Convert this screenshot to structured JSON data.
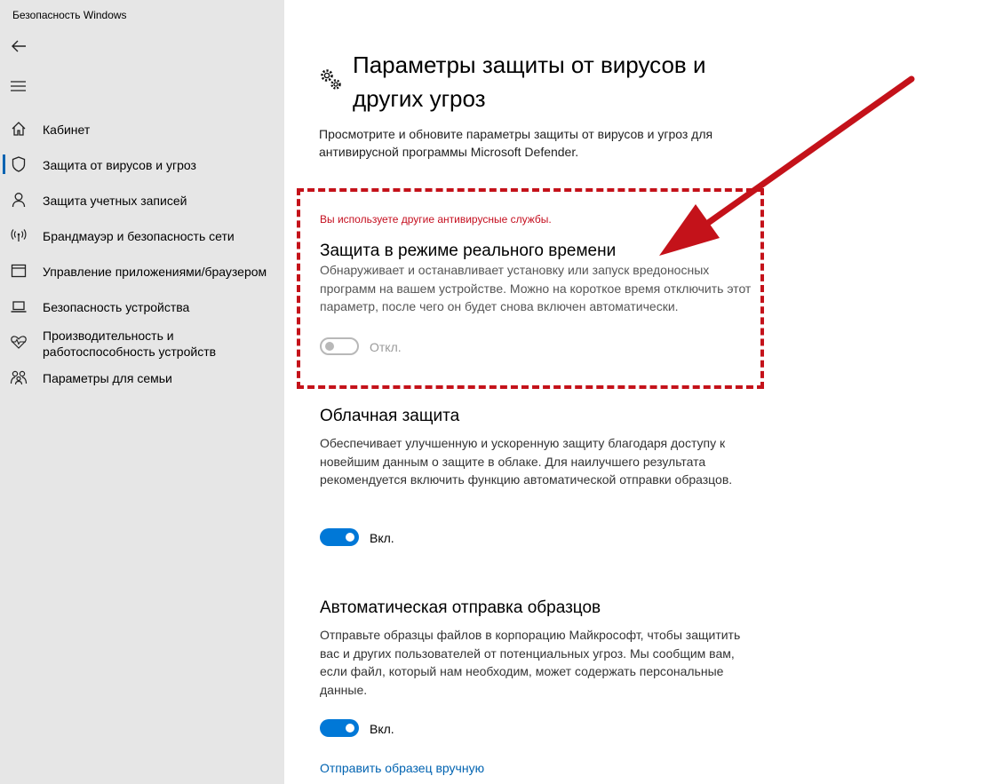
{
  "window": {
    "title": "Безопасность Windows"
  },
  "sidebar": {
    "items": [
      {
        "label": "Кабинет",
        "icon": "home-icon"
      },
      {
        "label": "Защита от вирусов и угроз",
        "icon": "shield-icon"
      },
      {
        "label": "Защита учетных записей",
        "icon": "person-icon"
      },
      {
        "label": "Брандмауэр и безопасность сети",
        "icon": "wifi-signal-icon"
      },
      {
        "label": "Управление приложениями/браузером",
        "icon": "app-window-icon"
      },
      {
        "label": "Безопасность устройства",
        "icon": "laptop-icon"
      },
      {
        "label": "Производительность и работоспособность устройств",
        "icon": "heart-pulse-icon"
      },
      {
        "label": "Параметры для семьи",
        "icon": "family-icon"
      }
    ]
  },
  "page": {
    "title": "Параметры защиты от вирусов и других угроз",
    "description": "Просмотрите и обновите параметры защиты от вирусов и угроз для антивирусной программы Microsoft Defender."
  },
  "realtime": {
    "warning": "Вы используете другие антивирусные службы.",
    "title": "Защита в режиме реального времени",
    "description": "Обнаруживает и останавливает установку или запуск вредоносных программ на вашем устройстве. Можно на короткое время отключить этот параметр, после чего он будет снова включен автоматически.",
    "toggle_label": "Откл."
  },
  "cloud": {
    "title": "Облачная защита",
    "description": "Обеспечивает улучшенную и ускоренную защиту благодаря доступу к новейшим данным о защите в облаке. Для наилучшего результата рекомендуется включить функцию автоматической отправки образцов.",
    "toggle_label": "Вкл."
  },
  "samples": {
    "title": "Автоматическая отправка образцов",
    "description": "Отправьте образцы файлов в корпорацию Майкрософт, чтобы защитить вас и других пользователей от потенциальных угроз. Мы сообщим вам, если файл, который нам необходим, может содержать персональные данные.",
    "toggle_label": "Вкл.",
    "manual_link": "Отправить образец вручную"
  },
  "colors": {
    "accent": "#0078d7",
    "warning": "#c50f1f",
    "annotation": "#c4121a",
    "sidebar_bg": "#e6e6e6"
  }
}
